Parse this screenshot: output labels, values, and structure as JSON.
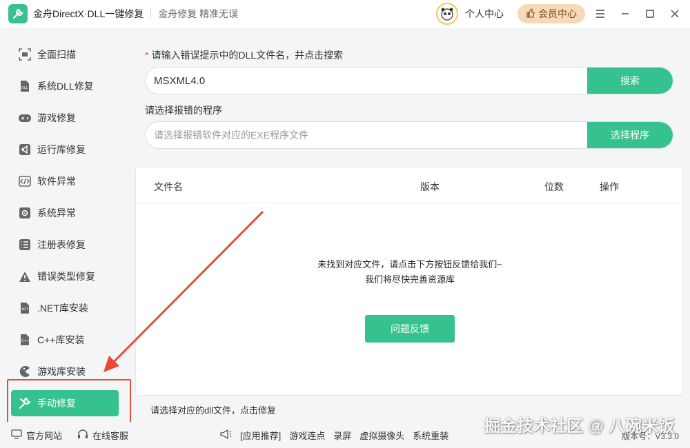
{
  "app": {
    "title": "金舟DirectX·DLL一键修复",
    "subtitle": "金舟修复 精准无误"
  },
  "header": {
    "personal_center": "个人中心",
    "vip_center": "会员中心"
  },
  "sidebar": {
    "items": [
      {
        "label": "全面扫描",
        "icon": "scan-icon"
      },
      {
        "label": "系统DLL修复",
        "icon": "dll-icon"
      },
      {
        "label": "游戏修复",
        "icon": "gamepad-icon"
      },
      {
        "label": "运行库修复",
        "icon": "visual-studio-icon"
      },
      {
        "label": "软件异常",
        "icon": "code-icon"
      },
      {
        "label": "系统异常",
        "icon": "gear-icon"
      },
      {
        "label": "注册表修复",
        "icon": "list-icon"
      },
      {
        "label": "错误类型修复",
        "icon": "warning-icon"
      },
      {
        "label": ".NET库安装",
        "icon": "dotnet-icon"
      },
      {
        "label": "C++库安装",
        "icon": "cpp-icon"
      },
      {
        "label": "游戏库安装",
        "icon": "pacman-icon"
      },
      {
        "label": "手动修复",
        "icon": "wrench-icon"
      }
    ]
  },
  "main": {
    "dll_label": "请输入错误提示中的DLL文件名，并点击搜索",
    "dll_value": "MSXML4.0",
    "search_button": "搜索",
    "program_label": "请选择报错的程序",
    "program_placeholder": "请选择报错软件对应的EXE程序文件",
    "select_program_button": "选择程序",
    "table_headers": [
      "文件名",
      "版本",
      "位数",
      "操作"
    ],
    "empty_line1": "未找到对应文件，请点击下方按钮反馈给我们~",
    "empty_line2": "我们将尽快完善资源库",
    "feedback_button": "问题反馈",
    "hint": "请选择对应的dll文件，点击修复"
  },
  "footer": {
    "official_site": "官方网站",
    "online_service": "在线客服",
    "recommend": "[应用推荐]",
    "links": [
      "游戏连点",
      "录屏",
      "虚拟摄像头",
      "系统重装"
    ],
    "version": "版本号：V3.3.0"
  },
  "watermark": "掘金技术社区 @ 八碗米饭",
  "colors": {
    "accent": "#36c28f",
    "annotation": "#e84a3a",
    "vip_bg": "#f6d9b7"
  }
}
